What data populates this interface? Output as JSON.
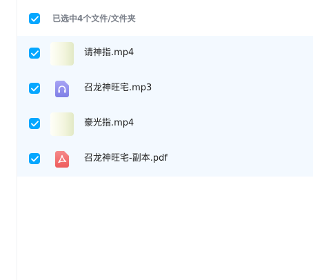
{
  "header": {
    "selection_text": "已选中4个文件/文件夹"
  },
  "files": [
    {
      "name": "请神指.mp4",
      "type": "video"
    },
    {
      "name": "召龙神旺宅.mp3",
      "type": "audio"
    },
    {
      "name": "豪光指.mp4",
      "type": "video"
    },
    {
      "name": "召龙神旺宅-副本.pdf",
      "type": "pdf"
    }
  ],
  "colors": {
    "accent": "#06a7ff",
    "selected_row_bg": "#f3f9ff",
    "audio_icon": "#8c8cf0",
    "pdf_icon": "#f06a6a"
  },
  "icons": {
    "checkbox": "check-icon",
    "audio": "headphones-icon",
    "pdf": "pdf-icon",
    "video": "video-thumbnail"
  }
}
